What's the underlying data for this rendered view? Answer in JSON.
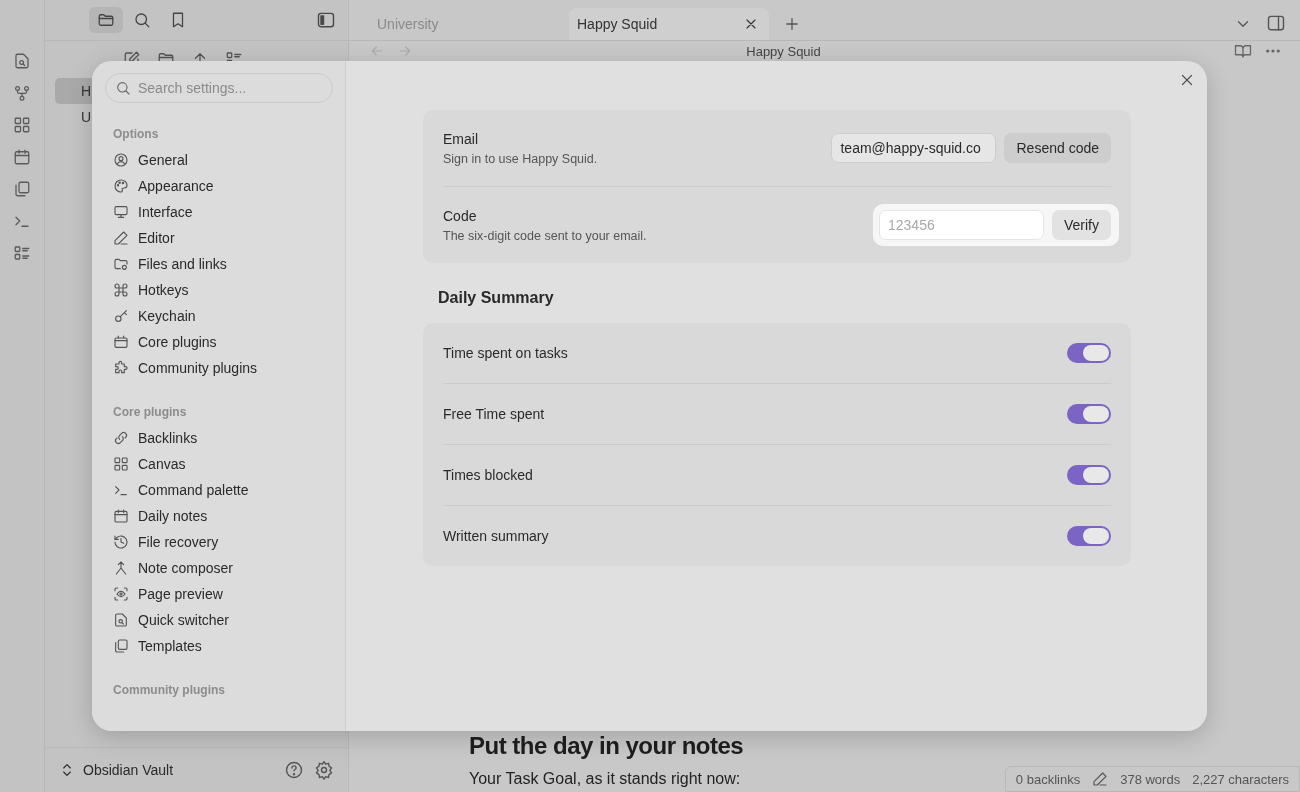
{
  "sidebar_tabs": [
    {
      "kind": "files",
      "selected": true
    },
    {
      "kind": "search",
      "selected": false
    },
    {
      "kind": "bookmarks",
      "selected": false
    }
  ],
  "files": [
    {
      "name": "H",
      "selected": true
    },
    {
      "name": "U",
      "selected": false
    }
  ],
  "vault": {
    "name": "Obsidian Vault"
  },
  "tabs": [
    {
      "label": "University",
      "selected": false
    },
    {
      "label": "Happy Squid",
      "selected": true
    }
  ],
  "note": {
    "title": "Happy Squid",
    "heading": "Put the day in your notes",
    "text": "Your Task Goal, as it stands right now:"
  },
  "status_bar": {
    "backlinks": "0 backlinks",
    "words": "378 words",
    "characters": "2,227 characters"
  },
  "settings": {
    "search": {
      "placeholder": "Search settings..."
    },
    "groups": [
      {
        "heading": "Options",
        "items": [
          {
            "label": "General",
            "kind": "user"
          },
          {
            "label": "Appearance",
            "kind": "palette"
          },
          {
            "label": "Interface",
            "kind": "monitor"
          },
          {
            "label": "Editor",
            "kind": "pencil"
          },
          {
            "label": "Files and links",
            "kind": "foldergear"
          },
          {
            "label": "Hotkeys",
            "kind": "command"
          },
          {
            "label": "Keychain",
            "kind": "key"
          },
          {
            "label": "Core plugins",
            "kind": "box"
          },
          {
            "label": "Community plugins",
            "kind": "puzzle"
          }
        ]
      },
      {
        "heading": "Core plugins",
        "items": [
          {
            "label": "Backlinks",
            "kind": "link"
          },
          {
            "label": "Canvas",
            "kind": "grid"
          },
          {
            "label": "Command palette",
            "kind": "terminal"
          },
          {
            "label": "Daily notes",
            "kind": "calendar"
          },
          {
            "label": "File recovery",
            "kind": "history"
          },
          {
            "label": "Note composer",
            "kind": "merge"
          },
          {
            "label": "Page preview",
            "kind": "eye"
          },
          {
            "label": "Quick switcher",
            "kind": "filesearch"
          },
          {
            "label": "Templates",
            "kind": "copy"
          }
        ]
      },
      {
        "heading": "Community plugins"
      }
    ],
    "sections": [
      {
        "rows": [
          {
            "kind": "input",
            "label": "Email",
            "description": "Sign in to use Happy Squid.",
            "value": "team@happy-squid.co",
            "button": "Resend code",
            "highlighted": false
          },
          {
            "kind": "input",
            "label": "Code",
            "description": "The six-digit code sent to your email.",
            "placeholder": "123456",
            "button": "Verify",
            "highlighted": true
          }
        ]
      },
      {
        "heading": "Daily Summary",
        "rows": [
          {
            "kind": "toggle",
            "label": "Time spent on tasks",
            "on": true
          },
          {
            "kind": "toggle",
            "label": "Free Time spent",
            "on": true
          },
          {
            "kind": "toggle",
            "label": "Times blocked",
            "on": true
          },
          {
            "kind": "toggle",
            "label": "Written summary",
            "on": true
          }
        ]
      }
    ]
  }
}
